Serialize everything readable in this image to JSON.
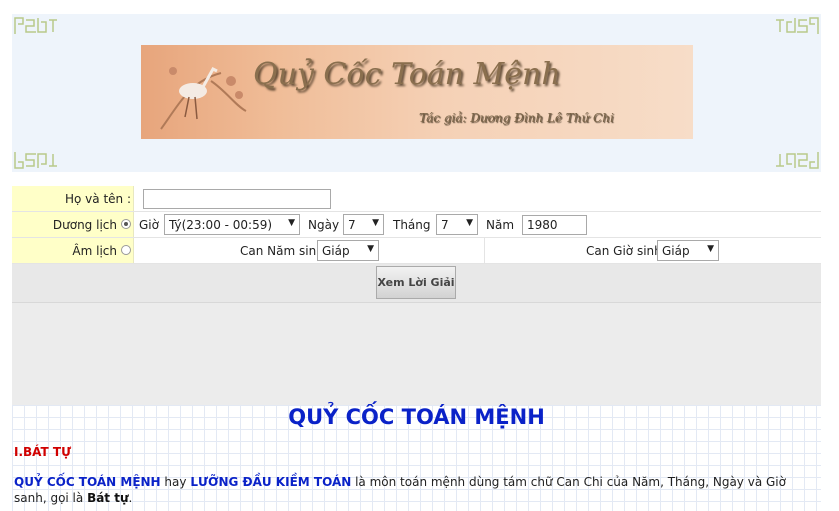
{
  "banner": {
    "title": "Quỷ Cốc Toán Mệnh",
    "author": "Tác giả: Dương Đình Lê Thứ Chi"
  },
  "form": {
    "name_label": "Họ và tên :",
    "name_value": "",
    "solar_label": "Dương lịch",
    "solar_selected": true,
    "hour_label": "Giờ",
    "hour_value": "Tý(23:00 - 00:59)",
    "day_label": "Ngày",
    "day_value": "7",
    "month_label": "Tháng",
    "month_value": "7",
    "year_label": "Năm",
    "year_value": "1980",
    "lunar_label": "Âm lịch",
    "lunar_selected": false,
    "can_year_label": "Can Năm sinh",
    "can_year_value": "Giáp",
    "can_hour_label": "Can Giờ sinh",
    "can_hour_value": "Giáp",
    "submit_label": "Xem Lời Giải"
  },
  "content": {
    "title": "QUỶ CỐC TOÁN MỆNH",
    "section": "I.BÁT TỰ",
    "p_term1": "QUỶ CỐC TOÁN MỆNH",
    "p_t1": " hay ",
    "p_term2": "LƯỠNG ĐẦU KIỀM TOÁN",
    "p_t2": " là môn toán mệnh dùng tám chữ Can Chi của Năm, Tháng, Ngày và Giờ sanh, gọi là ",
    "p_term3": "Bát tự",
    "p_end": "."
  },
  "colors": {
    "accent_blue": "#0a22c8",
    "section_red": "#d00000",
    "label_bg": "#ffffc8",
    "header_bg": "#eef4fb"
  },
  "icons": [
    "corner-ornament-icon",
    "crane-icon",
    "radio-icon",
    "dropdown-arrow-icon"
  ]
}
